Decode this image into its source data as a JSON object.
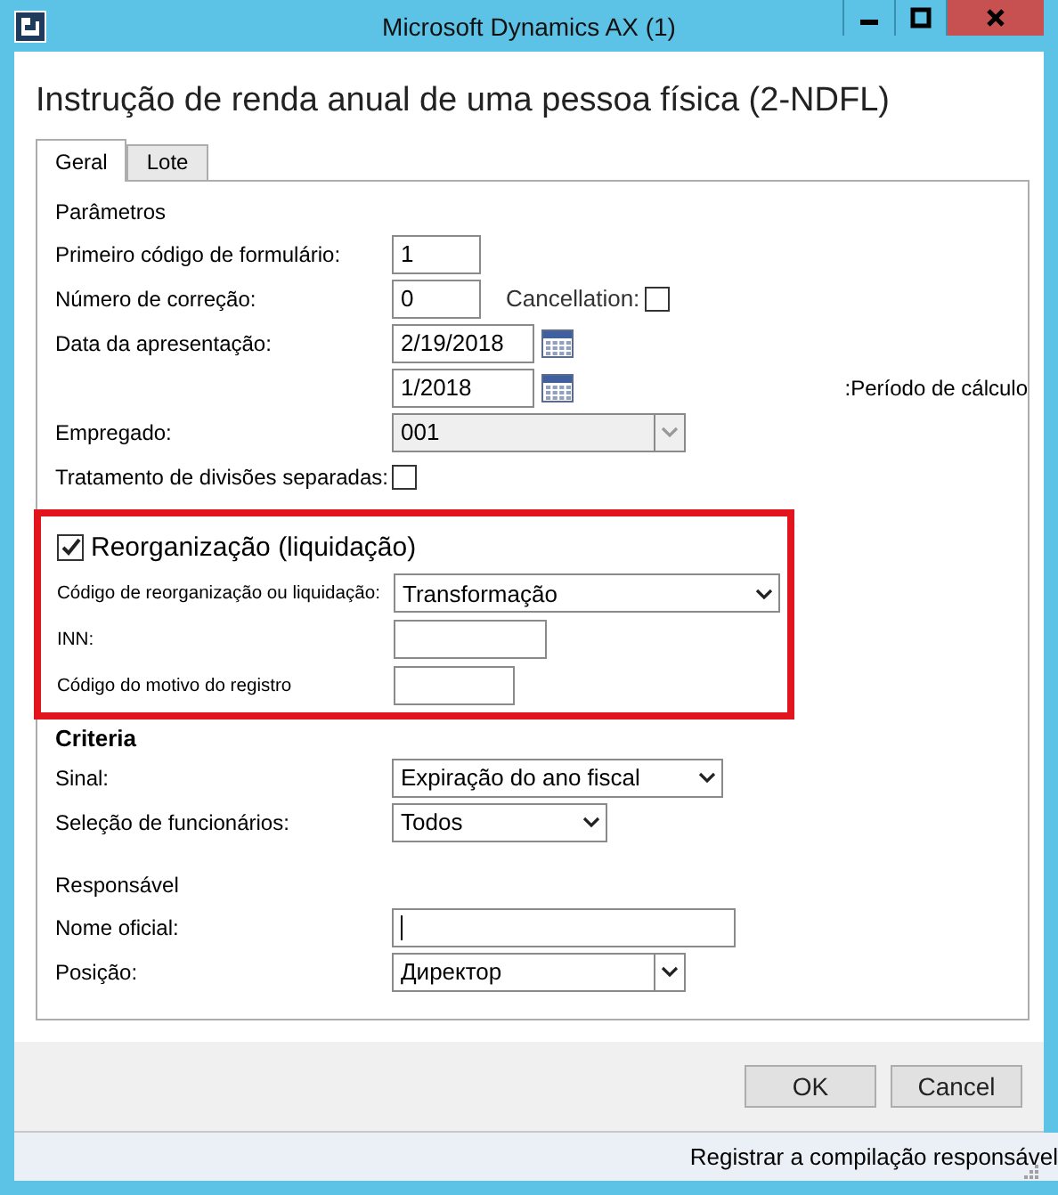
{
  "window": {
    "title": "Microsoft Dynamics AX (1)"
  },
  "form_title": "Instrução de renda anual de uma pessoa física (2-NDFL)",
  "tabs": [
    {
      "label": "Geral",
      "selected": true
    },
    {
      "label": "Lote",
      "selected": false
    }
  ],
  "groups": [
    {
      "kind": "plain",
      "heading": "Parâmetros",
      "rows": [
        {
          "kind": "text",
          "label": "Primeiro código de formulário:",
          "value": "1"
        },
        {
          "kind": "text",
          "label": "Número de correção:",
          "value": "0",
          "extra": {
            "label": "Cancellation:",
            "checked": false
          }
        },
        {
          "kind": "date",
          "label": "Data da apresentação:",
          "value": "2/19/2018"
        },
        {
          "kind": "date",
          "value": "1/2018",
          "side_label": ":Período de cálculo"
        },
        {
          "kind": "lookup",
          "label": "Empregado:",
          "value": "001",
          "disabled": true
        },
        {
          "kind": "checkbox",
          "label": "Tratamento de divisões separadas:",
          "checked": false
        }
      ]
    },
    {
      "kind": "highlighted",
      "heading": "Reorganização (liquidação)",
      "checked": true,
      "rows": [
        {
          "kind": "combo",
          "label": "Código de reorganização ou liquidação:",
          "value": "Transformação"
        },
        {
          "kind": "text",
          "label": "INN:"
        },
        {
          "kind": "text",
          "label": "Código do motivo do registro"
        }
      ]
    },
    {
      "kind": "bold",
      "heading": "Criteria",
      "rows": [
        {
          "kind": "combo",
          "label": "Sinal:",
          "value": "Expiração do ano fiscal"
        },
        {
          "kind": "combo",
          "label": "Seleção de funcionários:",
          "value": "Todos"
        }
      ]
    },
    {
      "kind": "plain",
      "heading": "Responsável",
      "rows": [
        {
          "kind": "text",
          "label": "Nome oficial:",
          "focused": true
        },
        {
          "kind": "lookup",
          "label": "Posição:",
          "value": "Директор",
          "disabled": false
        }
      ]
    }
  ],
  "buttons": [
    "OK",
    "Cancel"
  ],
  "status_bar": {
    "text": "Registrar a compilação responsável"
  }
}
